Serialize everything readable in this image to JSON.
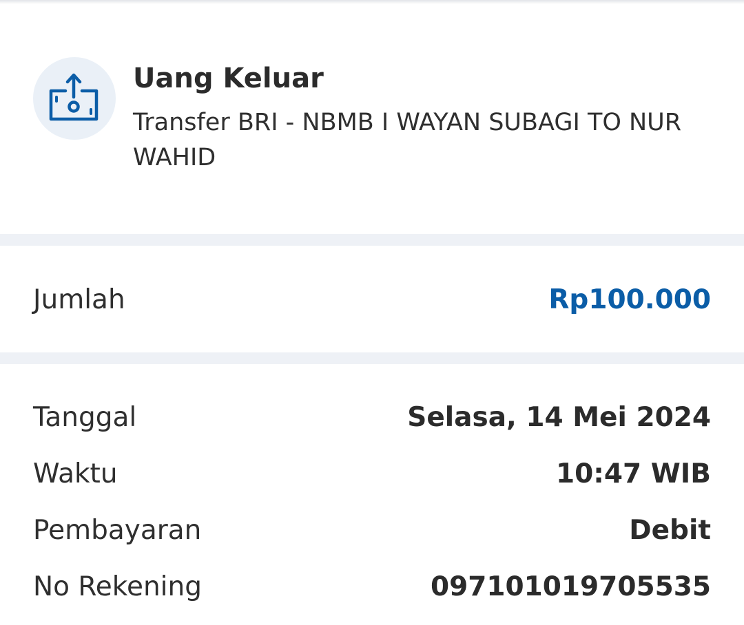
{
  "header": {
    "icon": "money-out-icon",
    "type_label": "Uang Keluar",
    "description": "Transfer BRI - NBMB I WAYAN SUBAGI TO NUR WAHID"
  },
  "amount": {
    "label": "Jumlah",
    "value": "Rp100.000"
  },
  "details": {
    "date": {
      "label": "Tanggal",
      "value": "Selasa, 14 Mei 2024"
    },
    "time": {
      "label": "Waktu",
      "value": "10:47 WIB"
    },
    "payment": {
      "label": "Pembayaran",
      "value": "Debit"
    },
    "account": {
      "label": "No Rekening",
      "value": "097101019705535"
    }
  },
  "colors": {
    "accent": "#0b5da7",
    "icon_bg": "#eaf0f7",
    "divider": "#eef1f6"
  }
}
